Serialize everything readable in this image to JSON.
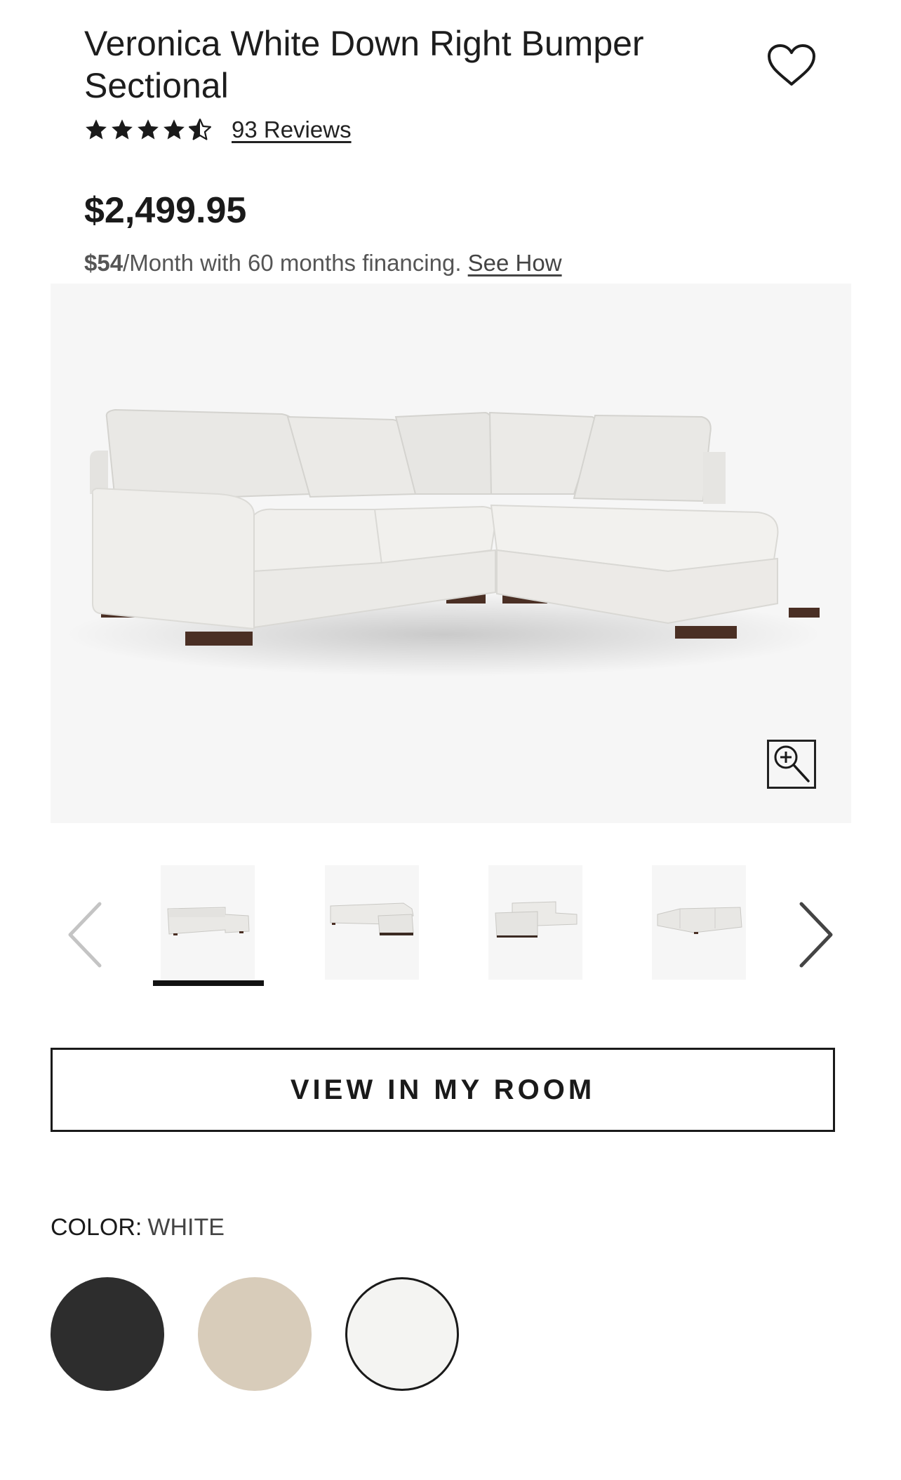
{
  "product": {
    "title": "Veronica White Down Right Bumper Sectional",
    "rating_value": 4.5,
    "rating_max": 5,
    "reviews_label": "93 Reviews",
    "price": "$2,499.95",
    "financing": {
      "amount": "$54",
      "text": "/Month with 60 months financing. ",
      "link": "See How"
    }
  },
  "gallery": {
    "main_image": "white-sectional-sofa-photo",
    "thumbnails": [
      {
        "name": "sectional-front-view",
        "selected": true
      },
      {
        "name": "sectional-side-view",
        "selected": false
      },
      {
        "name": "sectional-angle-view",
        "selected": false
      },
      {
        "name": "sectional-back-view",
        "selected": false
      }
    ],
    "icons": [
      "zoom-in-icon",
      "chevron-left-icon",
      "chevron-right-icon",
      "heart-icon",
      "star-icon"
    ]
  },
  "actions": {
    "view_in_room": "VIEW IN MY ROOM"
  },
  "color": {
    "label": "COLOR:",
    "value": "WHITE",
    "swatches": [
      {
        "name": "black",
        "color": "#2d2d2d",
        "selected": false
      },
      {
        "name": "beige",
        "color": "#d8ccba",
        "selected": false
      },
      {
        "name": "white",
        "color": "#f4f4f2",
        "selected": true
      }
    ]
  }
}
